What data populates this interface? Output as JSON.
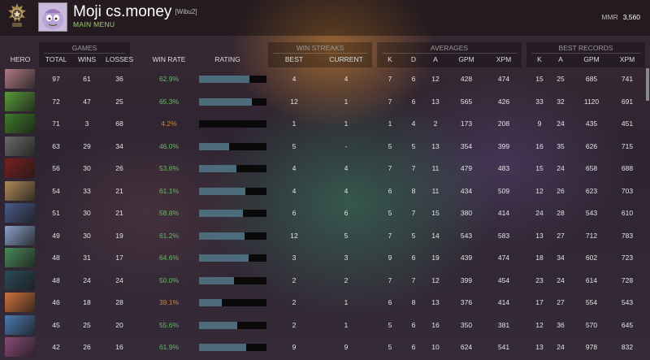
{
  "header": {
    "player_name": "Moji cs.money",
    "player_tag": "[Wibu2]",
    "menu_label": "MAIN MENU",
    "mmr_label": "MMR",
    "mmr_value": "3,560"
  },
  "groups": {
    "games": "GAMES",
    "win_streaks": "WIN STREAKS",
    "averages": "AVERAGES",
    "best_records": "BEST RECORDS"
  },
  "columns": {
    "hero": "HERO",
    "total": "TOTAL",
    "wins": "WINS",
    "losses": "LOSSES",
    "win_rate": "WIN RATE",
    "rating": "RATING",
    "best": "BEST",
    "current": "CURRENT",
    "avg_k": "K",
    "avg_d": "D",
    "avg_a": "A",
    "avg_gpm": "GPM",
    "avg_xpm": "XPM",
    "best_k": "K",
    "best_a": "A",
    "best_gpm": "GPM",
    "best_xpm": "XPM"
  },
  "rows": [
    {
      "total": "97",
      "wins": "61",
      "losses": "36",
      "win_rate": "62.9%",
      "rating": 0.75,
      "best": "4",
      "current": "4",
      "ak": "7",
      "ad": "6",
      "aa": "12",
      "agpm": "428",
      "axpm": "474",
      "bk": "15",
      "ba": "25",
      "bgpm": "685",
      "bxpm": "741",
      "portrait": "#b07a86"
    },
    {
      "total": "72",
      "wins": "47",
      "losses": "25",
      "win_rate": "65.3%",
      "rating": 0.78,
      "best": "12",
      "current": "1",
      "ak": "7",
      "ad": "6",
      "aa": "13",
      "agpm": "565",
      "axpm": "426",
      "bk": "33",
      "ba": "32",
      "bgpm": "1120",
      "bxpm": "691",
      "portrait": "#5a9a3a"
    },
    {
      "total": "71",
      "wins": "3",
      "losses": "68",
      "win_rate": "4.2%",
      "rating": 0.0,
      "best": "1",
      "current": "1",
      "ak": "1",
      "ad": "4",
      "aa": "2",
      "agpm": "173",
      "axpm": "208",
      "bk": "9",
      "ba": "24",
      "bgpm": "435",
      "bxpm": "451",
      "portrait": "#3f7a2a"
    },
    {
      "total": "63",
      "wins": "29",
      "losses": "34",
      "win_rate": "46.0%",
      "rating": 0.44,
      "best": "5",
      "current": "-",
      "ak": "5",
      "ad": "5",
      "aa": "13",
      "agpm": "354",
      "axpm": "399",
      "bk": "16",
      "ba": "35",
      "bgpm": "626",
      "bxpm": "715",
      "portrait": "#6a6a6a"
    },
    {
      "total": "56",
      "wins": "30",
      "losses": "26",
      "win_rate": "53.6%",
      "rating": 0.56,
      "best": "4",
      "current": "4",
      "ak": "7",
      "ad": "7",
      "aa": "11",
      "agpm": "479",
      "axpm": "483",
      "bk": "15",
      "ba": "24",
      "bgpm": "658",
      "bxpm": "688",
      "portrait": "#7a1e1e"
    },
    {
      "total": "54",
      "wins": "33",
      "losses": "21",
      "win_rate": "61.1%",
      "rating": 0.69,
      "best": "4",
      "current": "4",
      "ak": "6",
      "ad": "8",
      "aa": "11",
      "agpm": "434",
      "axpm": "509",
      "bk": "12",
      "ba": "26",
      "bgpm": "623",
      "bxpm": "703",
      "portrait": "#b08a5a"
    },
    {
      "total": "51",
      "wins": "30",
      "losses": "21",
      "win_rate": "58.8%",
      "rating": 0.65,
      "best": "6",
      "current": "6",
      "ak": "5",
      "ad": "7",
      "aa": "15",
      "agpm": "380",
      "axpm": "414",
      "bk": "24",
      "ba": "28",
      "bgpm": "543",
      "bxpm": "610",
      "portrait": "#4a5a8a"
    },
    {
      "total": "49",
      "wins": "30",
      "losses": "19",
      "win_rate": "61.2%",
      "rating": 0.68,
      "best": "12",
      "current": "5",
      "ak": "7",
      "ad": "5",
      "aa": "14",
      "agpm": "543",
      "axpm": "583",
      "bk": "13",
      "ba": "27",
      "bgpm": "712",
      "bxpm": "783",
      "portrait": "#8aa0c8"
    },
    {
      "total": "48",
      "wins": "31",
      "losses": "17",
      "win_rate": "64.6%",
      "rating": 0.73,
      "best": "3",
      "current": "3",
      "ak": "9",
      "ad": "6",
      "aa": "19",
      "agpm": "439",
      "axpm": "474",
      "bk": "18",
      "ba": "34",
      "bgpm": "602",
      "bxpm": "723",
      "portrait": "#4a8a5a"
    },
    {
      "total": "48",
      "wins": "24",
      "losses": "24",
      "win_rate": "50.0%",
      "rating": 0.52,
      "best": "2",
      "current": "2",
      "ak": "7",
      "ad": "7",
      "aa": "12",
      "agpm": "399",
      "axpm": "454",
      "bk": "23",
      "ba": "24",
      "bgpm": "614",
      "bxpm": "728",
      "portrait": "#2a4a5a"
    },
    {
      "total": "46",
      "wins": "18",
      "losses": "28",
      "win_rate": "39.1%",
      "rating": 0.34,
      "best": "2",
      "current": "1",
      "ak": "6",
      "ad": "8",
      "aa": "13",
      "agpm": "376",
      "axpm": "414",
      "bk": "17",
      "ba": "27",
      "bgpm": "554",
      "bxpm": "543",
      "portrait": "#d0703a"
    },
    {
      "total": "45",
      "wins": "25",
      "losses": "20",
      "win_rate": "55.6%",
      "rating": 0.57,
      "best": "2",
      "current": "1",
      "ak": "5",
      "ad": "6",
      "aa": "16",
      "agpm": "350",
      "axpm": "381",
      "bk": "12",
      "ba": "36",
      "bgpm": "570",
      "bxpm": "645",
      "portrait": "#4a7ab0"
    },
    {
      "total": "42",
      "wins": "26",
      "losses": "16",
      "win_rate": "61.9%",
      "rating": 0.7,
      "best": "9",
      "current": "9",
      "ak": "5",
      "ad": "6",
      "aa": "10",
      "agpm": "624",
      "axpm": "541",
      "bk": "13",
      "ba": "24",
      "bgpm": "978",
      "bxpm": "832",
      "portrait": "#8a4a7a"
    }
  ]
}
